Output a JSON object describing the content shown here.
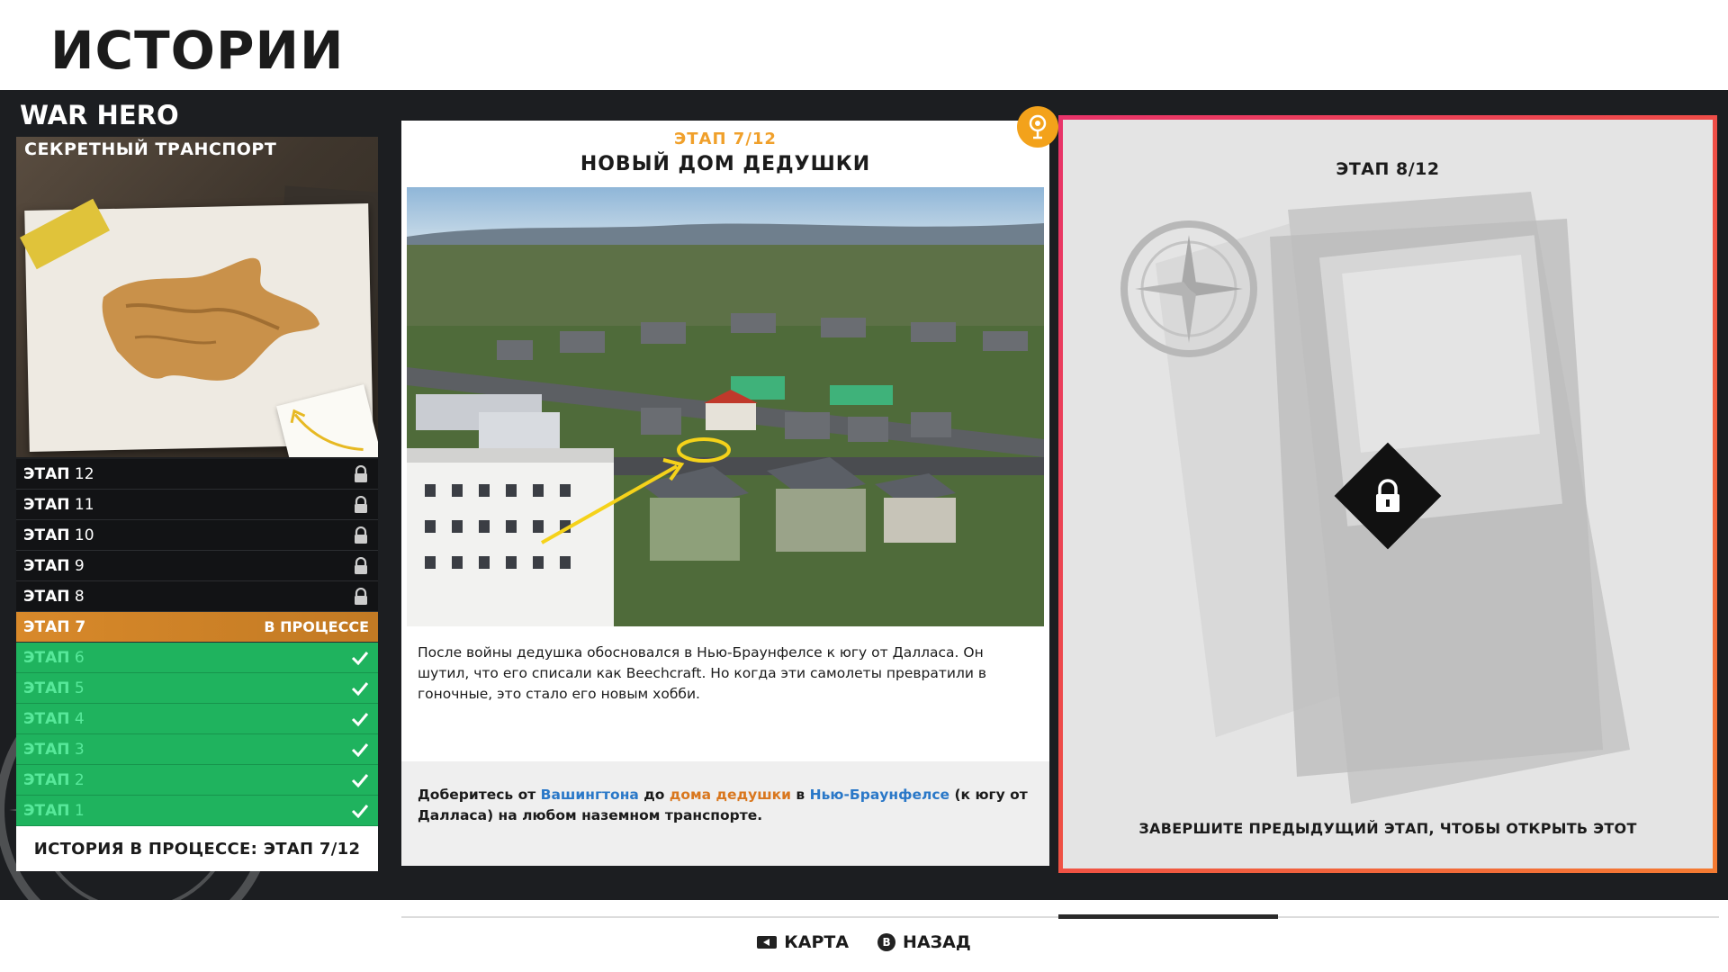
{
  "header": {
    "title": "ИСТОРИИ"
  },
  "story": {
    "name": "WAR HERO",
    "card_subtitle": "СЕКРЕТНЫЙ ТРАНСПОРТ",
    "progress_label": "ИСТОРИЯ В ПРОЦЕССЕ: ",
    "progress_value": "ЭТАП 7/12"
  },
  "stages": [
    {
      "label": "ЭТАП",
      "num": "12",
      "state": "locked"
    },
    {
      "label": "ЭТАП",
      "num": "11",
      "state": "locked"
    },
    {
      "label": "ЭТАП",
      "num": "10",
      "state": "locked"
    },
    {
      "label": "ЭТАП",
      "num": "9",
      "state": "locked"
    },
    {
      "label": "ЭТАП",
      "num": "8",
      "state": "locked"
    },
    {
      "label": "ЭТАП",
      "num": "7",
      "state": "active",
      "status": "В ПРОЦЕССЕ"
    },
    {
      "label": "ЭТАП",
      "num": "6",
      "state": "done"
    },
    {
      "label": "ЭТАП",
      "num": "5",
      "state": "done"
    },
    {
      "label": "ЭТАП",
      "num": "4",
      "state": "done"
    },
    {
      "label": "ЭТАП",
      "num": "3",
      "state": "done"
    },
    {
      "label": "ЭТАП",
      "num": "2",
      "state": "done"
    },
    {
      "label": "ЭТАП",
      "num": "1",
      "state": "done"
    }
  ],
  "current_stage": {
    "number": "ЭТАП 7/12",
    "title": "НОВЫЙ ДОМ ДЕДУШКИ",
    "description_part1": "После войны дедушка обосновался в Нью-Браунфелсе к югу от Далласа. Он шутил, что его списали как ",
    "description_beechcraft": "Beechcraft",
    "description_part2": ". Но когда эти самолеты превратили в гоночные, это стало его новым хобби.",
    "objective": {
      "part1": "Доберитесь от ",
      "loc1": "Вашингтона",
      "part2": " до ",
      "loc2": "дома дедушки",
      "part3": " в ",
      "loc3": "Нью-Браунфелсе",
      "part4": " (к югу от Далласа) на любом наземном транспорте."
    }
  },
  "locked_stage": {
    "number": "ЭТАП 8/12",
    "note": "ЗАВЕРШИТЕ ПРЕДЫДУЩИЙ ЭТАП, ЧТОБЫ ОТКРЫТЬ ЭТОТ"
  },
  "nav": {
    "map_label": "КАРТА",
    "back_label": "НАЗАД",
    "back_button_glyph": "B"
  },
  "colors": {
    "active": "#d8892a",
    "done": "#1fb35e",
    "accent_orange": "#f0a02b",
    "locked_border": "#e8336a",
    "link_blue": "#2a78c8"
  },
  "icons": [
    "lock-icon",
    "check-icon",
    "pin-icon",
    "compass-icon",
    "map-button-icon",
    "back-button-icon"
  ]
}
